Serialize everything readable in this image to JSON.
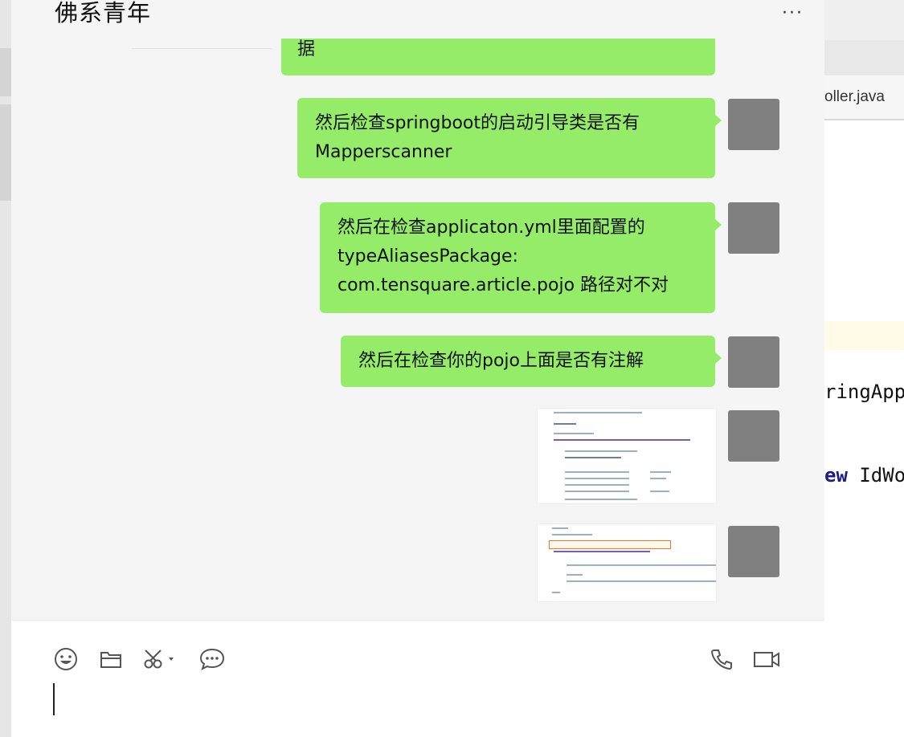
{
  "chat": {
    "title": "佛系青年",
    "more": "···",
    "messages": [
      {
        "type": "text",
        "text": "据"
      },
      {
        "type": "text",
        "text": "然后检查springboot的启动引导类是否有Mapperscanner"
      },
      {
        "type": "text",
        "text": "然后在检查applicaton.yml里面配置的typeAliasesPackage: com.tensquare.article.pojo 路径对不对"
      },
      {
        "type": "text",
        "text": "然后在检查你的pojo上面是否有注解"
      },
      {
        "type": "image",
        "alt": "code-screenshot-entity-class"
      },
      {
        "type": "image",
        "alt": "code-screenshot-application-class"
      }
    ]
  },
  "composer": {
    "tools": [
      "emoji-icon",
      "folder-icon",
      "scissors-icon",
      "chat-bubble-icon"
    ],
    "right_tools": [
      "phone-icon",
      "video-icon"
    ],
    "input_value": ""
  },
  "ide": {
    "tab_label": "oller.java",
    "code_lines": [
      {
        "plain": "ringApp"
      },
      {
        "kw": "ew",
        "plain": " IdWo"
      }
    ]
  }
}
